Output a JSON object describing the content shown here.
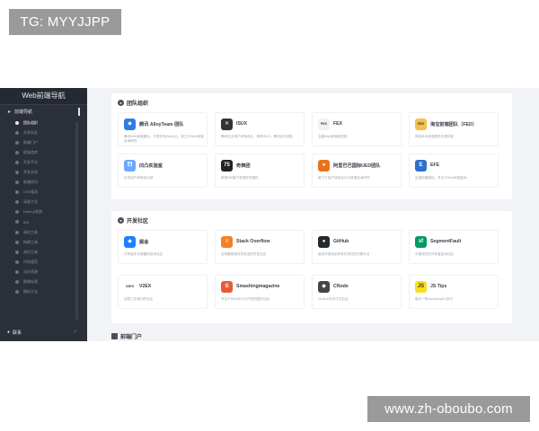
{
  "overlay": {
    "tg_label": "TG: MYYJJPP",
    "watermark": "www.zh-oboubo.com"
  },
  "sidebar": {
    "title": "Web前端导航",
    "group_label": "前端导航",
    "items": [
      {
        "label": "团队组织",
        "active": true
      },
      {
        "label": "开发社区",
        "active": false
      },
      {
        "label": "前端门户",
        "active": false
      },
      {
        "label": "框架类库",
        "active": false
      },
      {
        "label": "开发平台",
        "active": false
      },
      {
        "label": "开发文档",
        "active": false
      },
      {
        "label": "前端资讯",
        "active": false
      },
      {
        "label": "CSS相关",
        "active": false
      },
      {
        "label": "动画大全",
        "active": false
      },
      {
        "label": "Node.js相关",
        "active": false
      },
      {
        "label": "IDE",
        "active": false
      },
      {
        "label": "调试工具",
        "active": false
      },
      {
        "label": "构建工具",
        "active": false
      },
      {
        "label": "测试工具",
        "active": false
      },
      {
        "label": "代码规范",
        "active": false
      },
      {
        "label": "设计资源",
        "active": false
      },
      {
        "label": "图像处理",
        "active": false
      },
      {
        "label": "图标大全",
        "active": false
      }
    ],
    "footer_label": "联系"
  },
  "sections": [
    {
      "title": "团队组织",
      "icon": "team-icon",
      "cards": [
        {
          "name": "腾讯 AlloyTeam 团队",
          "desc": "腾讯Web前端团队，代表作品WebQQ，致力于Web前端技术研究",
          "icon_color": "#2d7be5",
          "glyph": "◆"
        },
        {
          "name": "ISUX",
          "desc": "腾讯社交用户体验设计，简称ISUX，腾讯设计团队",
          "icon_color": "#333333",
          "glyph": "✕"
        },
        {
          "name": "FEX",
          "desc": "百度Web前端研发部",
          "icon_color": "#f0f1f4",
          "glyph": "FEX"
        },
        {
          "name": "淘宝前端团队（FED）",
          "desc": "用技术为体验提供无限可能",
          "icon_color": "#f5c04a",
          "glyph": "FED"
        },
        {
          "name": "凹凸实验室",
          "desc": "京东用户体验设计部",
          "icon_color": "#6aa7ff",
          "glyph": "凹"
        },
        {
          "name": "奇舞团",
          "desc": "奇虎360旗下前端开发团队",
          "icon_color": "#222222",
          "glyph": "75"
        },
        {
          "name": "阿里巴巴国际UED团队",
          "desc": "致力于用户体验设计与前端技术研究",
          "icon_color": "#e8731a",
          "glyph": "●"
        },
        {
          "name": "EFE",
          "desc": "百度前端团队，专注于Web前端技术",
          "icon_color": "#2f6fce",
          "glyph": "E"
        }
      ]
    },
    {
      "title": "开发社区",
      "icon": "chat-icon",
      "cards": [
        {
          "name": "掘金",
          "desc": "只有高手才能懂的技术社区",
          "icon_color": "#1e80ff",
          "glyph": "◆"
        },
        {
          "name": "Stack Overflow",
          "desc": "全球最受程序员欢迎的开发社区",
          "icon_color": "#f48024",
          "glyph": "≡"
        },
        {
          "name": "GitHub",
          "desc": "面向开源及私有软件项目的托管平台",
          "icon_color": "#24292e",
          "glyph": "●"
        },
        {
          "name": "SegmentFault",
          "desc": "中国领先的开发者技术社区",
          "icon_color": "#009a61",
          "glyph": "sf"
        },
        {
          "name": "V2EX",
          "desc": "创意工作者们的社区",
          "icon_color": "#ffffff",
          "glyph": "V2EX"
        },
        {
          "name": "Smashingmagazine",
          "desc": "专注于Web设计与开发的国外社区",
          "icon_color": "#e85c33",
          "glyph": "S"
        },
        {
          "name": "CNode",
          "desc": "Node.js专业中文社区",
          "icon_color": "#444444",
          "glyph": "◆"
        },
        {
          "name": "JS Tips",
          "desc": "每天一条JavaScript小技巧",
          "icon_color": "#f7df1e",
          "glyph": "JS"
        }
      ]
    }
  ],
  "next_section_title": "前端门户"
}
